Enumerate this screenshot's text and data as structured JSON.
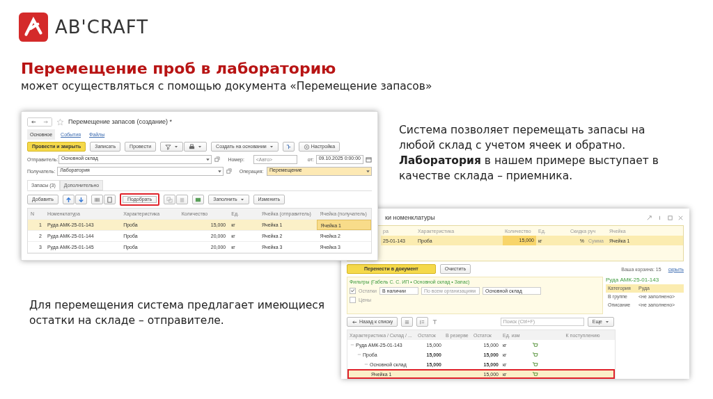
{
  "logo": {
    "text": "AB'CRAFT"
  },
  "heading": {
    "title": "Перемещение проб в лабораторию",
    "subtitle": "может осуществляться с помощью документа «Перемещение запасов»"
  },
  "doc": {
    "title": "Перемещение запасов (создание) *",
    "favorite": false,
    "tabs": [
      {
        "label": "Основное",
        "selected": true
      },
      {
        "label": "События",
        "selected": false
      },
      {
        "label": "Файлы",
        "selected": false
      }
    ],
    "toolbar": [
      {
        "kind": "primary",
        "label": "Провести и закрыть"
      },
      {
        "kind": "button",
        "label": "Записать"
      },
      {
        "kind": "button",
        "label": "Провести"
      },
      {
        "kind": "filter-print"
      },
      {
        "kind": "dropdown",
        "label": "Создать на основании"
      },
      {
        "kind": "structure"
      },
      {
        "kind": "settings",
        "label": "Настройка"
      }
    ],
    "sender": {
      "label": "Отправитель:",
      "value": "Основной склад"
    },
    "number": {
      "label": "Номер:",
      "placeholder": "<Авто>"
    },
    "date": {
      "label": "от:",
      "value": "09.10.2025  0:00:00"
    },
    "receiver": {
      "label": "Получатель:",
      "value": "Лаборатория"
    },
    "operation": {
      "label": "Операция:",
      "value": "Перемещение"
    },
    "subtabs": [
      {
        "label": "Запасы (3)",
        "selected": true
      },
      {
        "label": "Дополнительно",
        "selected": false
      }
    ],
    "table_toolbar": [
      {
        "kind": "button",
        "label": "Добавить",
        "highlighted": false
      },
      {
        "kind": "arrows"
      },
      {
        "kind": "icons"
      },
      {
        "kind": "button",
        "label": "Подобрать",
        "highlighted": true
      },
      {
        "kind": "copy"
      },
      {
        "kind": "excel"
      },
      {
        "kind": "dropdown",
        "label": "Заполнить",
        "highlighted": false
      },
      {
        "kind": "button",
        "label": "Изменить",
        "highlighted": false
      }
    ],
    "columns": [
      "N",
      "Номенклатура",
      "Характеристика",
      "Количество",
      "Ед.",
      "Ячейка (отправитель)",
      "Ячейка (получатель)"
    ],
    "rows": [
      {
        "n": "1",
        "item": "Руда  АМК-25-01-143",
        "char": "Проба",
        "qty": "15,000",
        "unit": "кг",
        "from": "Ячейка 1",
        "to": "Ячейка 1",
        "selected": true
      },
      {
        "n": "2",
        "item": "Руда  АМК-25-01-144",
        "char": "Проба",
        "qty": "20,000",
        "unit": "кг",
        "from": "Ячейка 2",
        "to": "Ячейка 2",
        "selected": false
      },
      {
        "n": "3",
        "item": "Руда  АМК-25-01-145",
        "char": "Проба",
        "qty": "20,000",
        "unit": "кг",
        "from": "Ячейка 3",
        "to": "Ячейка 3",
        "selected": false
      }
    ]
  },
  "notes": [
    {
      "text": "Система позволяет перемещать запасы на любой склад с учетом ячеек и обратно. **Лаборатория** в нашем примере выступает в качестве склада – приемника."
    },
    {
      "text": "Для перемещения система предлагает имеющиеся остатки на складе – отправителе."
    }
  ],
  "pick": {
    "title": "ки номенклатуры",
    "cart": {
      "columns": {
        "item": "ра",
        "char": "Характеристика",
        "qty": "Количество",
        "unit": "Ед.",
        "discount": "Скидка руч",
        "cell": "Ячейка"
      },
      "rows": [
        {
          "item": "25-01-143",
          "char": "Проба",
          "qty": "15,000",
          "unit": "кг",
          "percent": "%",
          "sum": "Сумма",
          "cell": "Ячейка 1",
          "selected": true
        }
      ]
    },
    "transfer_button": "Перенести в документ",
    "clear_button": "Очистить",
    "cart_count": "Ваша корзина: 15",
    "hide_link": "скрыть",
    "filters": {
      "title": "Фильтры (Габель С. С. ИП • Основной склад • Запас)",
      "stock": {
        "label": "Остатки",
        "checked": true
      },
      "availability": "В наличии",
      "org_placeholder": "По всем организациям",
      "warehouse": "Основной склад",
      "prices": {
        "label": "Цены",
        "checked": false
      }
    },
    "details": {
      "title": "Руда  АМК-25-01-143",
      "rows": [
        {
          "label": "Категория",
          "value": "Руда",
          "selected": true
        },
        {
          "label": "В группе",
          "value": "<не заполнено>",
          "selected": false
        },
        {
          "label": "Описание",
          "value": "<не заполнено>",
          "selected": false
        }
      ]
    },
    "back_button": "Назад к списку",
    "search_placeholder": "Поиск (Ctrl+F)",
    "more_button": "Еще",
    "tree": {
      "columns": {
        "name": "Характеристика / Склад / ...",
        "rest": "Остаток",
        "reserve": "В резерве",
        "rest2": "Остаток",
        "unit": "Ед. изм",
        "incoming": "К поступлению"
      },
      "rows": [
        {
          "name": "Руда  АМК-25-01-143",
          "rest": "15,000",
          "rest2": "15,000",
          "unit": "кг",
          "bold": false,
          "expanded": true,
          "selected": false,
          "highlighted": false,
          "children": [
            {
              "name": "Проба",
              "rest": "15,000",
              "rest2": "15,000",
              "unit": "кг",
              "bold": true,
              "expanded": true,
              "selected": false,
              "highlighted": false,
              "children": [
                {
                  "name": "Основной склад",
                  "rest": "15,000",
                  "rest2": "15,000",
                  "unit": "кг",
                  "bold": true,
                  "expanded": true,
                  "selected": false,
                  "highlighted": false,
                  "children": [
                    {
                      "name": "Ячейка 1",
                      "rest2": "15,000",
                      "unit": "кг",
                      "bold": false,
                      "selected": true,
                      "highlighted": true
                    }
                  ]
                }
              ]
            }
          ]
        }
      ]
    }
  }
}
